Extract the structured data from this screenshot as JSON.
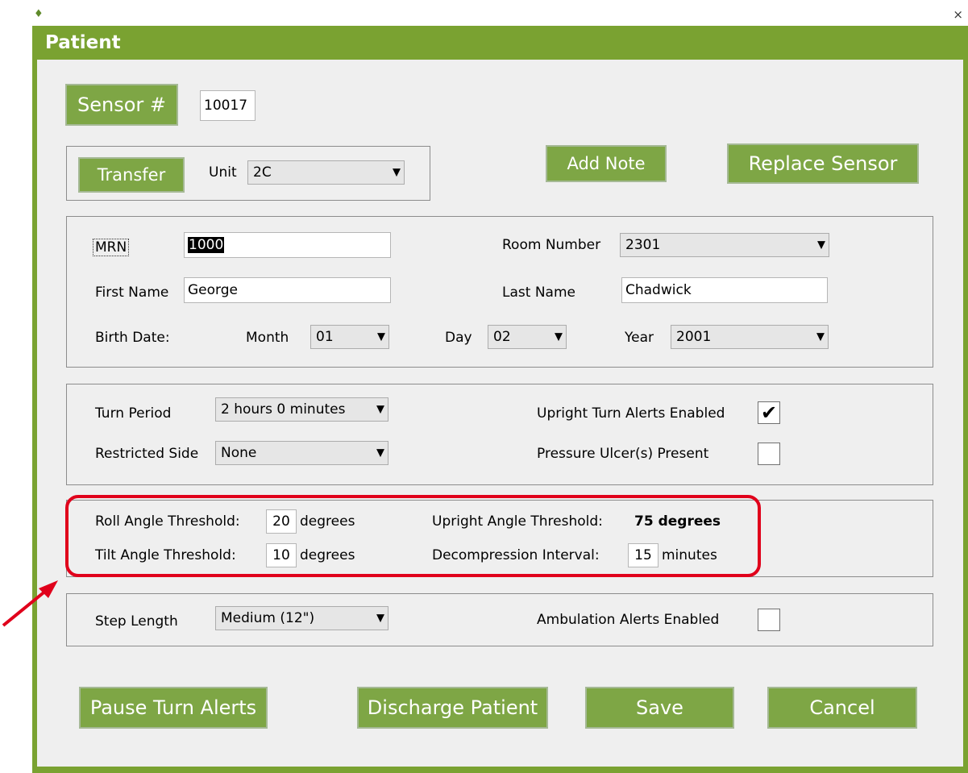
{
  "window": {
    "title": "Patient",
    "close_glyph": "×",
    "app_icon": "leaf-icon"
  },
  "sensor": {
    "button": "Sensor #",
    "value": "10017"
  },
  "transfer": {
    "button": "Transfer",
    "unit_label": "Unit",
    "unit_value": "2C"
  },
  "actions": {
    "add_note": "Add Note",
    "replace_sensor": "Replace Sensor"
  },
  "patient": {
    "mrn_label": "MRN",
    "mrn_value": "1000",
    "room_label": "Room Number",
    "room_value": "2301",
    "first_name_label": "First Name",
    "first_name_value": "George",
    "last_name_label": "Last Name",
    "last_name_value": "Chadwick",
    "birth_date_label": "Birth Date:",
    "month_label": "Month",
    "month_value": "01",
    "day_label": "Day",
    "day_value": "02",
    "year_label": "Year",
    "year_value": "2001"
  },
  "turn": {
    "period_label": "Turn Period",
    "period_value": "2 hours 0 minutes",
    "restricted_label": "Restricted Side",
    "restricted_value": "None",
    "upright_alerts_label": "Upright Turn Alerts Enabled",
    "upright_alerts_checked": true,
    "pressure_ulcer_label": "Pressure Ulcer(s) Present",
    "pressure_ulcer_checked": false
  },
  "thresholds": {
    "roll_label": "Roll Angle Threshold:",
    "roll_value": "20",
    "roll_unit": "degrees",
    "tilt_label": "Tilt Angle Threshold:",
    "tilt_value": "10",
    "tilt_unit": "degrees",
    "upright_label": "Upright Angle Threshold:",
    "upright_value": "75 degrees",
    "decompression_label": "Decompression Interval:",
    "decompression_value": "15",
    "decompression_unit": "minutes"
  },
  "ambulation": {
    "step_label": "Step Length",
    "step_value": "Medium (12\")",
    "alerts_label": "Ambulation Alerts Enabled",
    "alerts_checked": false
  },
  "footer": {
    "pause": "Pause Turn Alerts",
    "discharge": "Discharge Patient",
    "save": "Save",
    "cancel": "Cancel"
  },
  "colors": {
    "title_bar": "#7aa231",
    "button": "#7ea645",
    "highlight": "#e0001b"
  },
  "dropdown_arrow": "▼",
  "checkmark": "✔"
}
